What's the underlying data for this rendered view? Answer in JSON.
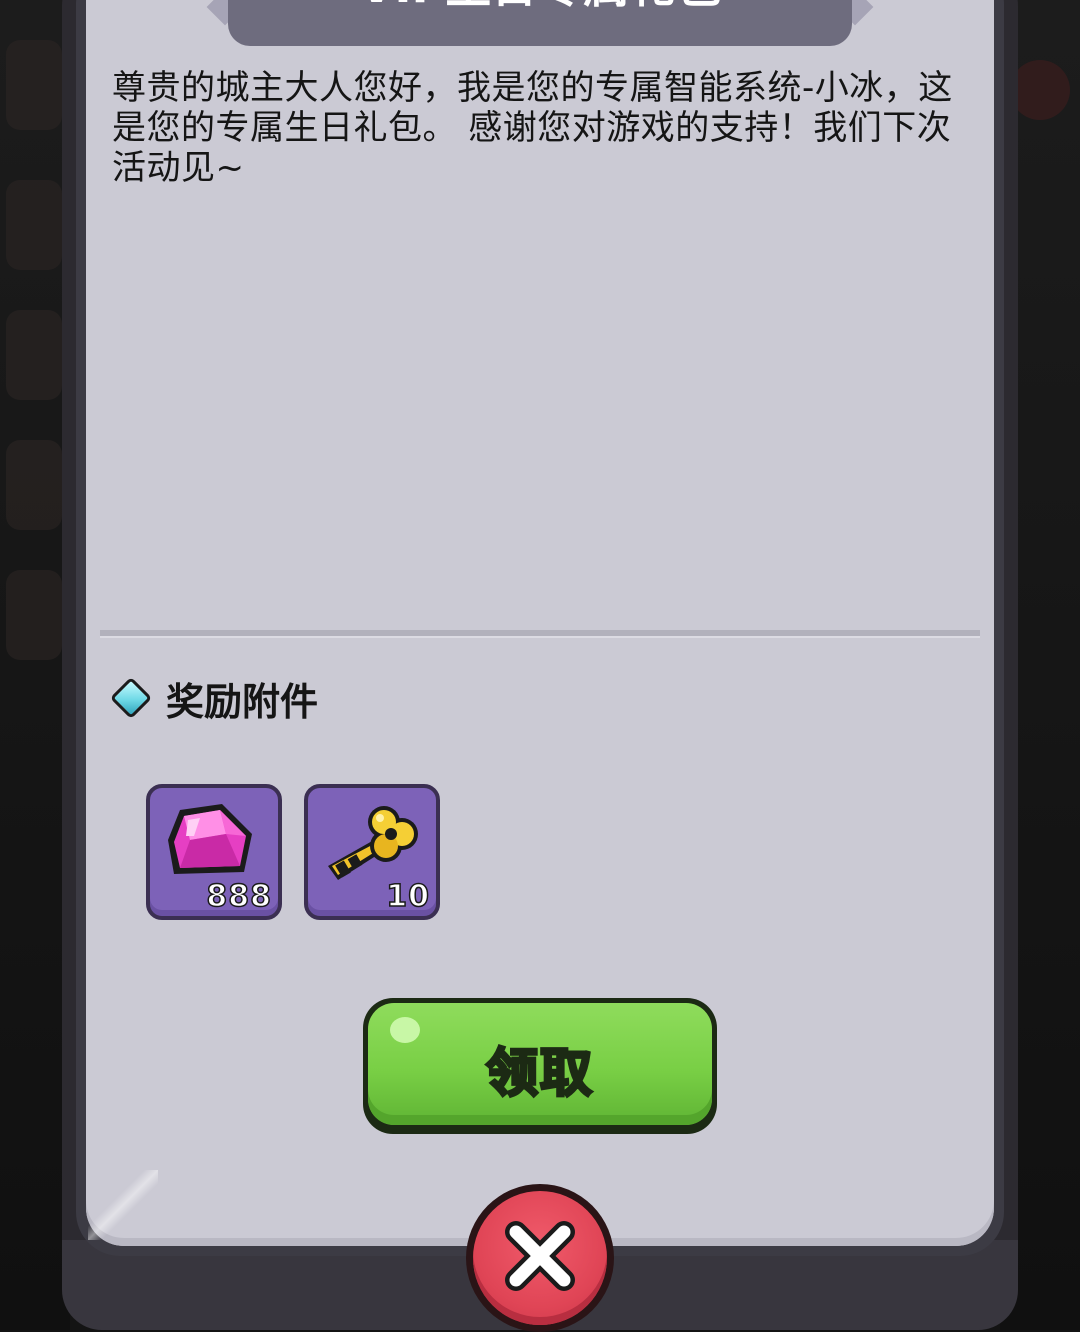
{
  "dialog": {
    "title": "VIP生日专属礼包",
    "message": "尊贵的城主大人您好，我是您的专属智能系统-小冰，这是您的专属生日礼包。 感谢您对游戏的支持！我们下次活动见~"
  },
  "rewards": {
    "heading": "奖励附件",
    "items": [
      {
        "icon": "pink-gem-icon",
        "quantity": "888"
      },
      {
        "icon": "gold-key-icon",
        "quantity": "10"
      }
    ]
  },
  "buttons": {
    "claim_label": "领取",
    "close_icon": "close-icon"
  },
  "colors": {
    "panel": "#cbcad4",
    "banner": "#6e6c7e",
    "item_tile": "#7d62b8",
    "claim_green": "#79cf45",
    "close_red": "#e04556"
  }
}
